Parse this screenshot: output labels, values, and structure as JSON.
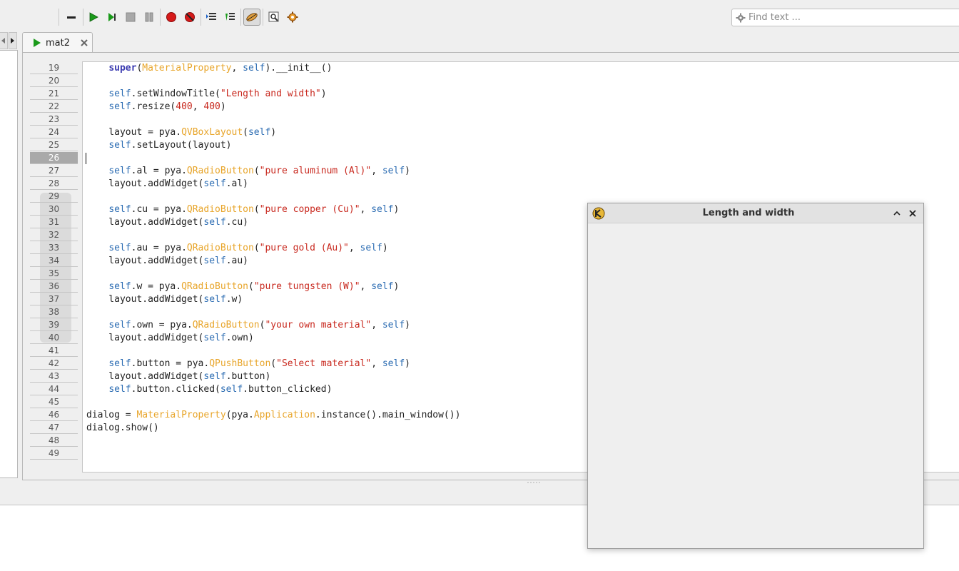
{
  "toolbar": {
    "buttons": [
      {
        "name": "collapse-icon"
      },
      {
        "name": "run-icon"
      },
      {
        "name": "step-icon"
      },
      {
        "name": "stop-icon"
      },
      {
        "name": "pause-icon"
      },
      {
        "name": "breakpoint-icon"
      },
      {
        "name": "clear-breakpoints-icon"
      },
      {
        "name": "indent-icon"
      },
      {
        "name": "outdent-icon"
      },
      {
        "name": "edit-mode-icon"
      },
      {
        "name": "inspect-icon"
      },
      {
        "name": "settings-icon"
      }
    ],
    "search_placeholder": "Find text ..."
  },
  "tab": {
    "label": "mat2"
  },
  "editor": {
    "current_line": "26",
    "line_numbers": [
      "19",
      "20",
      "21",
      "22",
      "23",
      "24",
      "25",
      "26",
      "27",
      "28",
      "29",
      "30",
      "31",
      "32",
      "33",
      "34",
      "35",
      "36",
      "37",
      "38",
      "39",
      "40",
      "41",
      "42",
      "43",
      "44",
      "45",
      "46",
      "47",
      "48",
      "49"
    ]
  },
  "code": {
    "l19": "super",
    "l19b": "MaterialProperty",
    "l19c": "self",
    "l19d": ").__init__()",
    "l21a": "self",
    "l21b": ".setWindowTitle(",
    "l21c": "\"Length and width\"",
    "l21d": ")",
    "l22a": "self",
    "l22b": ".resize(",
    "l22c": "400",
    "l22d": ", ",
    "l22e": "400",
    "l22f": ")",
    "l24a": "    layout = pya.",
    "l24b": "QVBoxLayout",
    "l24c": "(",
    "l24d": "self",
    "l24e": ")",
    "l25a": "self",
    "l25b": ".setLayout(layout)",
    "l27a": "self",
    "l27b": ".al = pya.",
    "l27c": "QRadioButton",
    "l27d": "(",
    "l27e": "\"pure aluminum (Al)\"",
    "l27f": ", ",
    "l27g": "self",
    "l27h": ")",
    "l28a": "    layout.addWidget(",
    "l28b": "self",
    "l28c": ".al)",
    "l30a": "self",
    "l30b": ".cu = pya.",
    "l30c": "QRadioButton",
    "l30d": "(",
    "l30e": "\"pure copper (Cu)\"",
    "l30f": ", ",
    "l30g": "self",
    "l30h": ")",
    "l31a": "    layout.addWidget(",
    "l31b": "self",
    "l31c": ".cu)",
    "l33a": "self",
    "l33b": ".au = pya.",
    "l33c": "QRadioButton",
    "l33d": "(",
    "l33e": "\"pure gold (Au)\"",
    "l33f": ", ",
    "l33g": "self",
    "l33h": ")",
    "l34a": "    layout.addWidget(",
    "l34b": "self",
    "l34c": ".au)",
    "l36a": "self",
    "l36b": ".w = pya.",
    "l36c": "QRadioButton",
    "l36d": "(",
    "l36e": "\"pure tungsten (W)\"",
    "l36f": ", ",
    "l36g": "self",
    "l36h": ")",
    "l37a": "    layout.addWidget(",
    "l37b": "self",
    "l37c": ".w)",
    "l39a": "self",
    "l39b": ".own = pya.",
    "l39c": "QRadioButton",
    "l39d": "(",
    "l39e": "\"your own material\"",
    "l39f": ", ",
    "l39g": "self",
    "l39h": ")",
    "l40a": "    layout.addWidget(",
    "l40b": "self",
    "l40c": ".own)",
    "l42a": "self",
    "l42b": ".button = pya.",
    "l42c": "QPushButton",
    "l42d": "(",
    "l42e": "\"Select material\"",
    "l42f": ", ",
    "l42g": "self",
    "l42h": ")",
    "l43a": "    layout.addWidget(",
    "l43b": "self",
    "l43c": ".button)",
    "l44a": "self",
    "l44b": ".button.clicked(",
    "l44c": "self",
    "l44d": ".button_clicked)",
    "l46a": "dialog = ",
    "l46b": "MaterialProperty",
    "l46c": "(pya.",
    "l46d": "Application",
    "l46e": ".instance().main_window())",
    "l47": "dialog.show()"
  },
  "dialog": {
    "title": "Length and width"
  },
  "colors": {
    "keyword": "#3b3bb0",
    "self": "#2a6bb2",
    "class": "#e8a52a",
    "string": "#c8281e"
  }
}
